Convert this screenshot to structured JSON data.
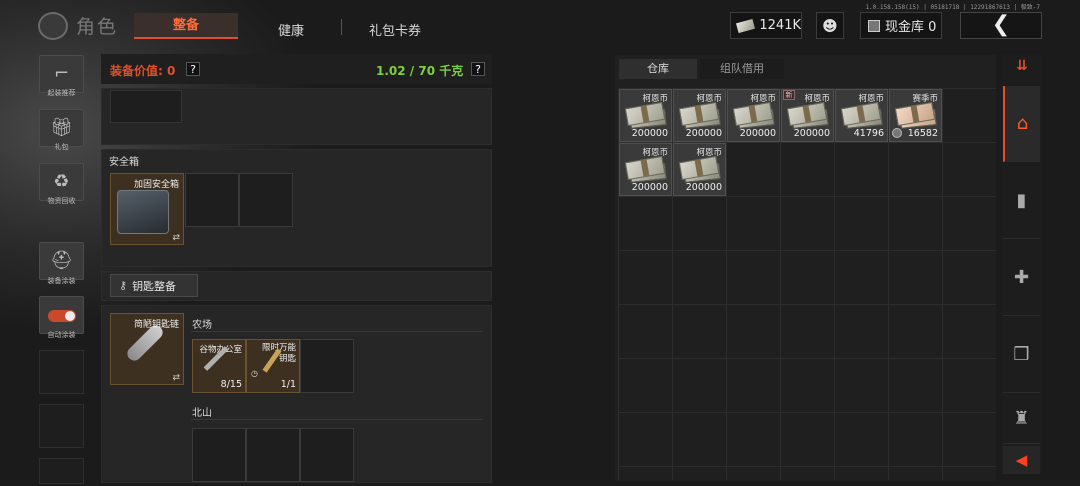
{
  "version": "1.0.158.158(15) | 05181718 | 12291867613 | 极致-7",
  "header": {
    "title": "角色",
    "tabs": [
      {
        "label": "整备",
        "active": true
      },
      {
        "label": "健康",
        "active": false
      },
      {
        "label": "礼包卡券",
        "active": false
      }
    ],
    "currency_amount": "1241K",
    "cash_vault_label": "现金库 0",
    "back_icon": "chevron-left-icon"
  },
  "left_sidebar": {
    "items": [
      {
        "label": "起装推荐",
        "icon": "gun-icon"
      },
      {
        "label": "礼包",
        "icon": "gift-icon"
      },
      {
        "label": "物资回收",
        "icon": "recycle-icon"
      },
      {
        "label": "装备涂装",
        "icon": "helmet-icon"
      },
      {
        "label": "自动涂装",
        "icon": "toggle-icon",
        "toggle_on": true
      }
    ]
  },
  "equipment": {
    "value_label": "装备价值: 0",
    "weight_label": "1.02 / 70 千克",
    "weight_color": "#7fd13b",
    "accent_color": "#e0502a"
  },
  "safe_box": {
    "section_label": "安全箱",
    "item_name": "加固安全箱",
    "swap_icon": "⇄"
  },
  "key_gear": {
    "button_label": "钥匙整备",
    "item_name": "简陋钥匙链",
    "swap_icon": "⇄",
    "maps": [
      {
        "name": "农场",
        "keys": [
          {
            "name": "谷物办公室",
            "count": "8/15"
          },
          {
            "name": "限时万能钥匙",
            "count": "1/1"
          }
        ]
      },
      {
        "name": "北山",
        "keys": []
      }
    ]
  },
  "warehouse": {
    "tabs": [
      {
        "label": "仓库",
        "active": true
      },
      {
        "label": "组队借用",
        "active": false
      }
    ],
    "new_tag": "新",
    "items": [
      {
        "name": "柯恩币",
        "qty": "200000",
        "style": "green"
      },
      {
        "name": "柯恩币",
        "qty": "200000",
        "style": "green"
      },
      {
        "name": "柯恩币",
        "qty": "200000",
        "style": "green"
      },
      {
        "name": "柯恩币",
        "qty": "200000",
        "style": "green"
      },
      {
        "name": "柯恩币",
        "qty": "41796",
        "style": "green"
      },
      {
        "name": "赛季币",
        "qty": "16582",
        "style": "pink"
      },
      {
        "name": "柯恩币",
        "qty": "200000",
        "style": "green"
      },
      {
        "name": "柯恩币",
        "qty": "200000",
        "style": "green"
      }
    ]
  },
  "right_sidebar": {
    "top_icon": "filter-icon",
    "items": [
      {
        "icon": "home-icon",
        "active": true
      },
      {
        "icon": "magazine-icon",
        "active": false
      },
      {
        "icon": "medkit-icon",
        "active": false
      },
      {
        "icon": "box-icon",
        "active": false
      },
      {
        "icon": "armor-icon",
        "active": false
      }
    ],
    "collapse_icon": "caret-left-icon"
  }
}
